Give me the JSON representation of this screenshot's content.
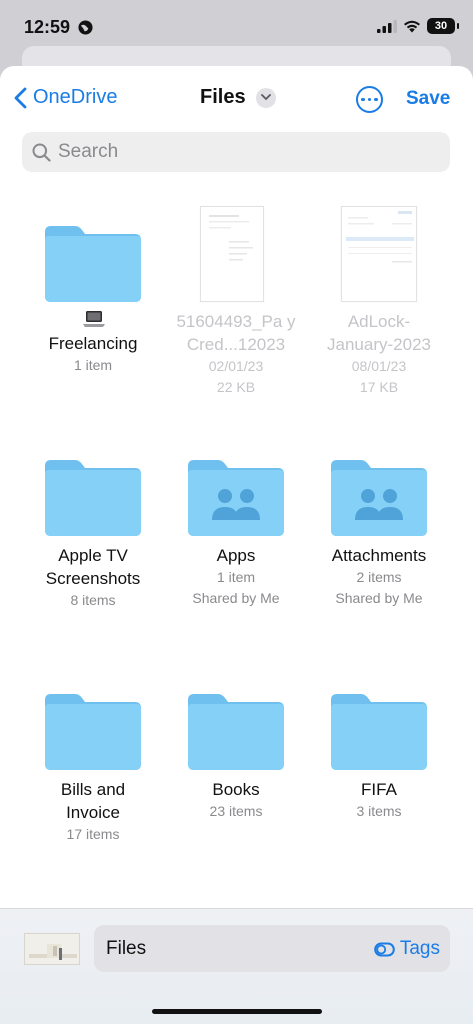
{
  "status": {
    "time": "12:59",
    "battery": "30"
  },
  "nav": {
    "back_label": "OneDrive",
    "title": "Files",
    "save_label": "Save"
  },
  "search": {
    "placeholder": "Search"
  },
  "items": [
    {
      "name": "Freelancing",
      "meta": "1 item"
    },
    {
      "name": "51604493_Pa y Cred...12023",
      "date": "02/01/23",
      "size": "22 KB"
    },
    {
      "name": "AdLock- January-2023",
      "date": "08/01/23",
      "size": "17 KB"
    },
    {
      "name": "Apple TV Screenshots",
      "meta": "8 items"
    },
    {
      "name": "Apps",
      "meta": "1 item",
      "shared": "Shared by Me"
    },
    {
      "name": "Attachments",
      "meta": "2 items",
      "shared": "Shared by Me"
    },
    {
      "name": "Bills and Invoice",
      "meta": "17 items"
    },
    {
      "name": "Books",
      "meta": "23 items"
    },
    {
      "name": "FIFA",
      "meta": "3 items"
    }
  ],
  "bottom": {
    "location": "Files",
    "tags_label": "Tags"
  },
  "colors": {
    "accent": "#1a7ce6",
    "folder": "#7fccf5",
    "folder_dark": "#5fb3e8"
  }
}
